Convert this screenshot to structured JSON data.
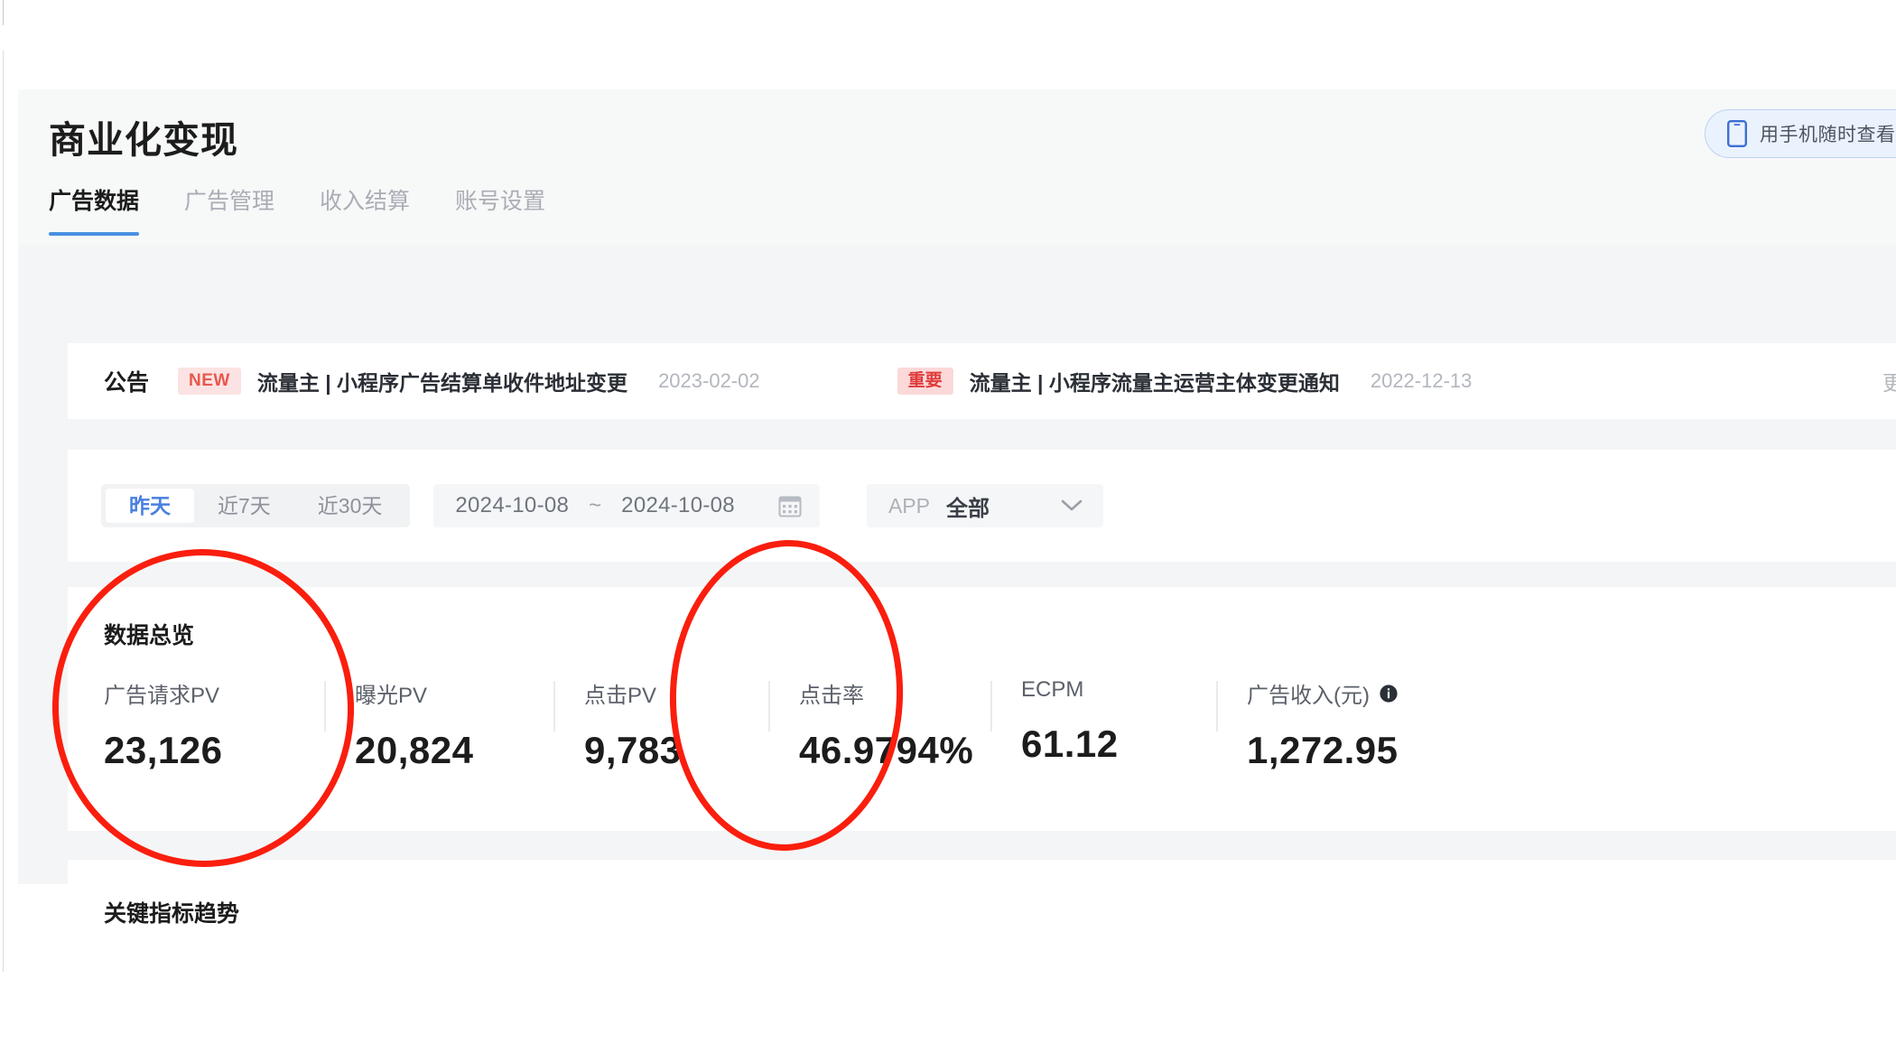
{
  "header": {
    "title": "商业化变现",
    "phone_button": {
      "icon": "phone-icon",
      "label": "用手机随时查看数据"
    }
  },
  "tabs": [
    {
      "label": "广告数据",
      "active": true
    },
    {
      "label": "广告管理",
      "active": false
    },
    {
      "label": "收入结算",
      "active": false
    },
    {
      "label": "账号设置",
      "active": false
    }
  ],
  "announcement": {
    "label": "公告",
    "more": "更多",
    "items": [
      {
        "badge": "NEW",
        "badge_type": "new",
        "text": "流量主 | 小程序广告结算单收件地址变更",
        "date": "2023-02-02"
      },
      {
        "badge": "重要",
        "badge_type": "important",
        "text": "流量主 | 小程序流量主运营主体变更通知",
        "date": "2022-12-13"
      }
    ]
  },
  "filters": {
    "range_presets": [
      {
        "label": "昨天",
        "active": true
      },
      {
        "label": "近7天",
        "active": false
      },
      {
        "label": "近30天",
        "active": false
      }
    ],
    "date_start": "2024-10-08",
    "date_separator": "~",
    "date_end": "2024-10-08",
    "calendar_icon": "calendar-icon",
    "app_select": {
      "label": "APP",
      "value": "全部",
      "chevron": "chevron-down-icon"
    }
  },
  "overview": {
    "title": "数据总览",
    "metrics": [
      {
        "label": "广告请求PV",
        "value": "23,126",
        "has_info": false
      },
      {
        "label": "曝光PV",
        "value": "20,824",
        "has_info": false
      },
      {
        "label": "点击PV",
        "value": "9,783",
        "has_info": false
      },
      {
        "label": "点击率",
        "value": "46.9794%",
        "has_info": false
      },
      {
        "label": "ECPM",
        "value": "61.12",
        "has_info": false
      },
      {
        "label": "广告收入(元)",
        "value": "1,272.95",
        "has_info": true
      }
    ]
  },
  "trend": {
    "title": "关键指标趋势"
  },
  "annotations": {
    "color": "#fa1e0e",
    "shapes": [
      {
        "type": "ellipse",
        "targets": "广告请求PV 23,126"
      },
      {
        "type": "ellipse",
        "targets": "点击PV 9,783"
      }
    ]
  },
  "colors": {
    "accent": "#4a90e2",
    "page_bg": "#f4f5f6",
    "card_bg": "#ffffff",
    "badge_new_bg": "#fce3e3",
    "badge_new_fg": "#e8574c",
    "badge_important_bg": "#fbd9d9",
    "badge_important_fg": "#e03a3a",
    "annotation_red": "#fa1e0e"
  }
}
